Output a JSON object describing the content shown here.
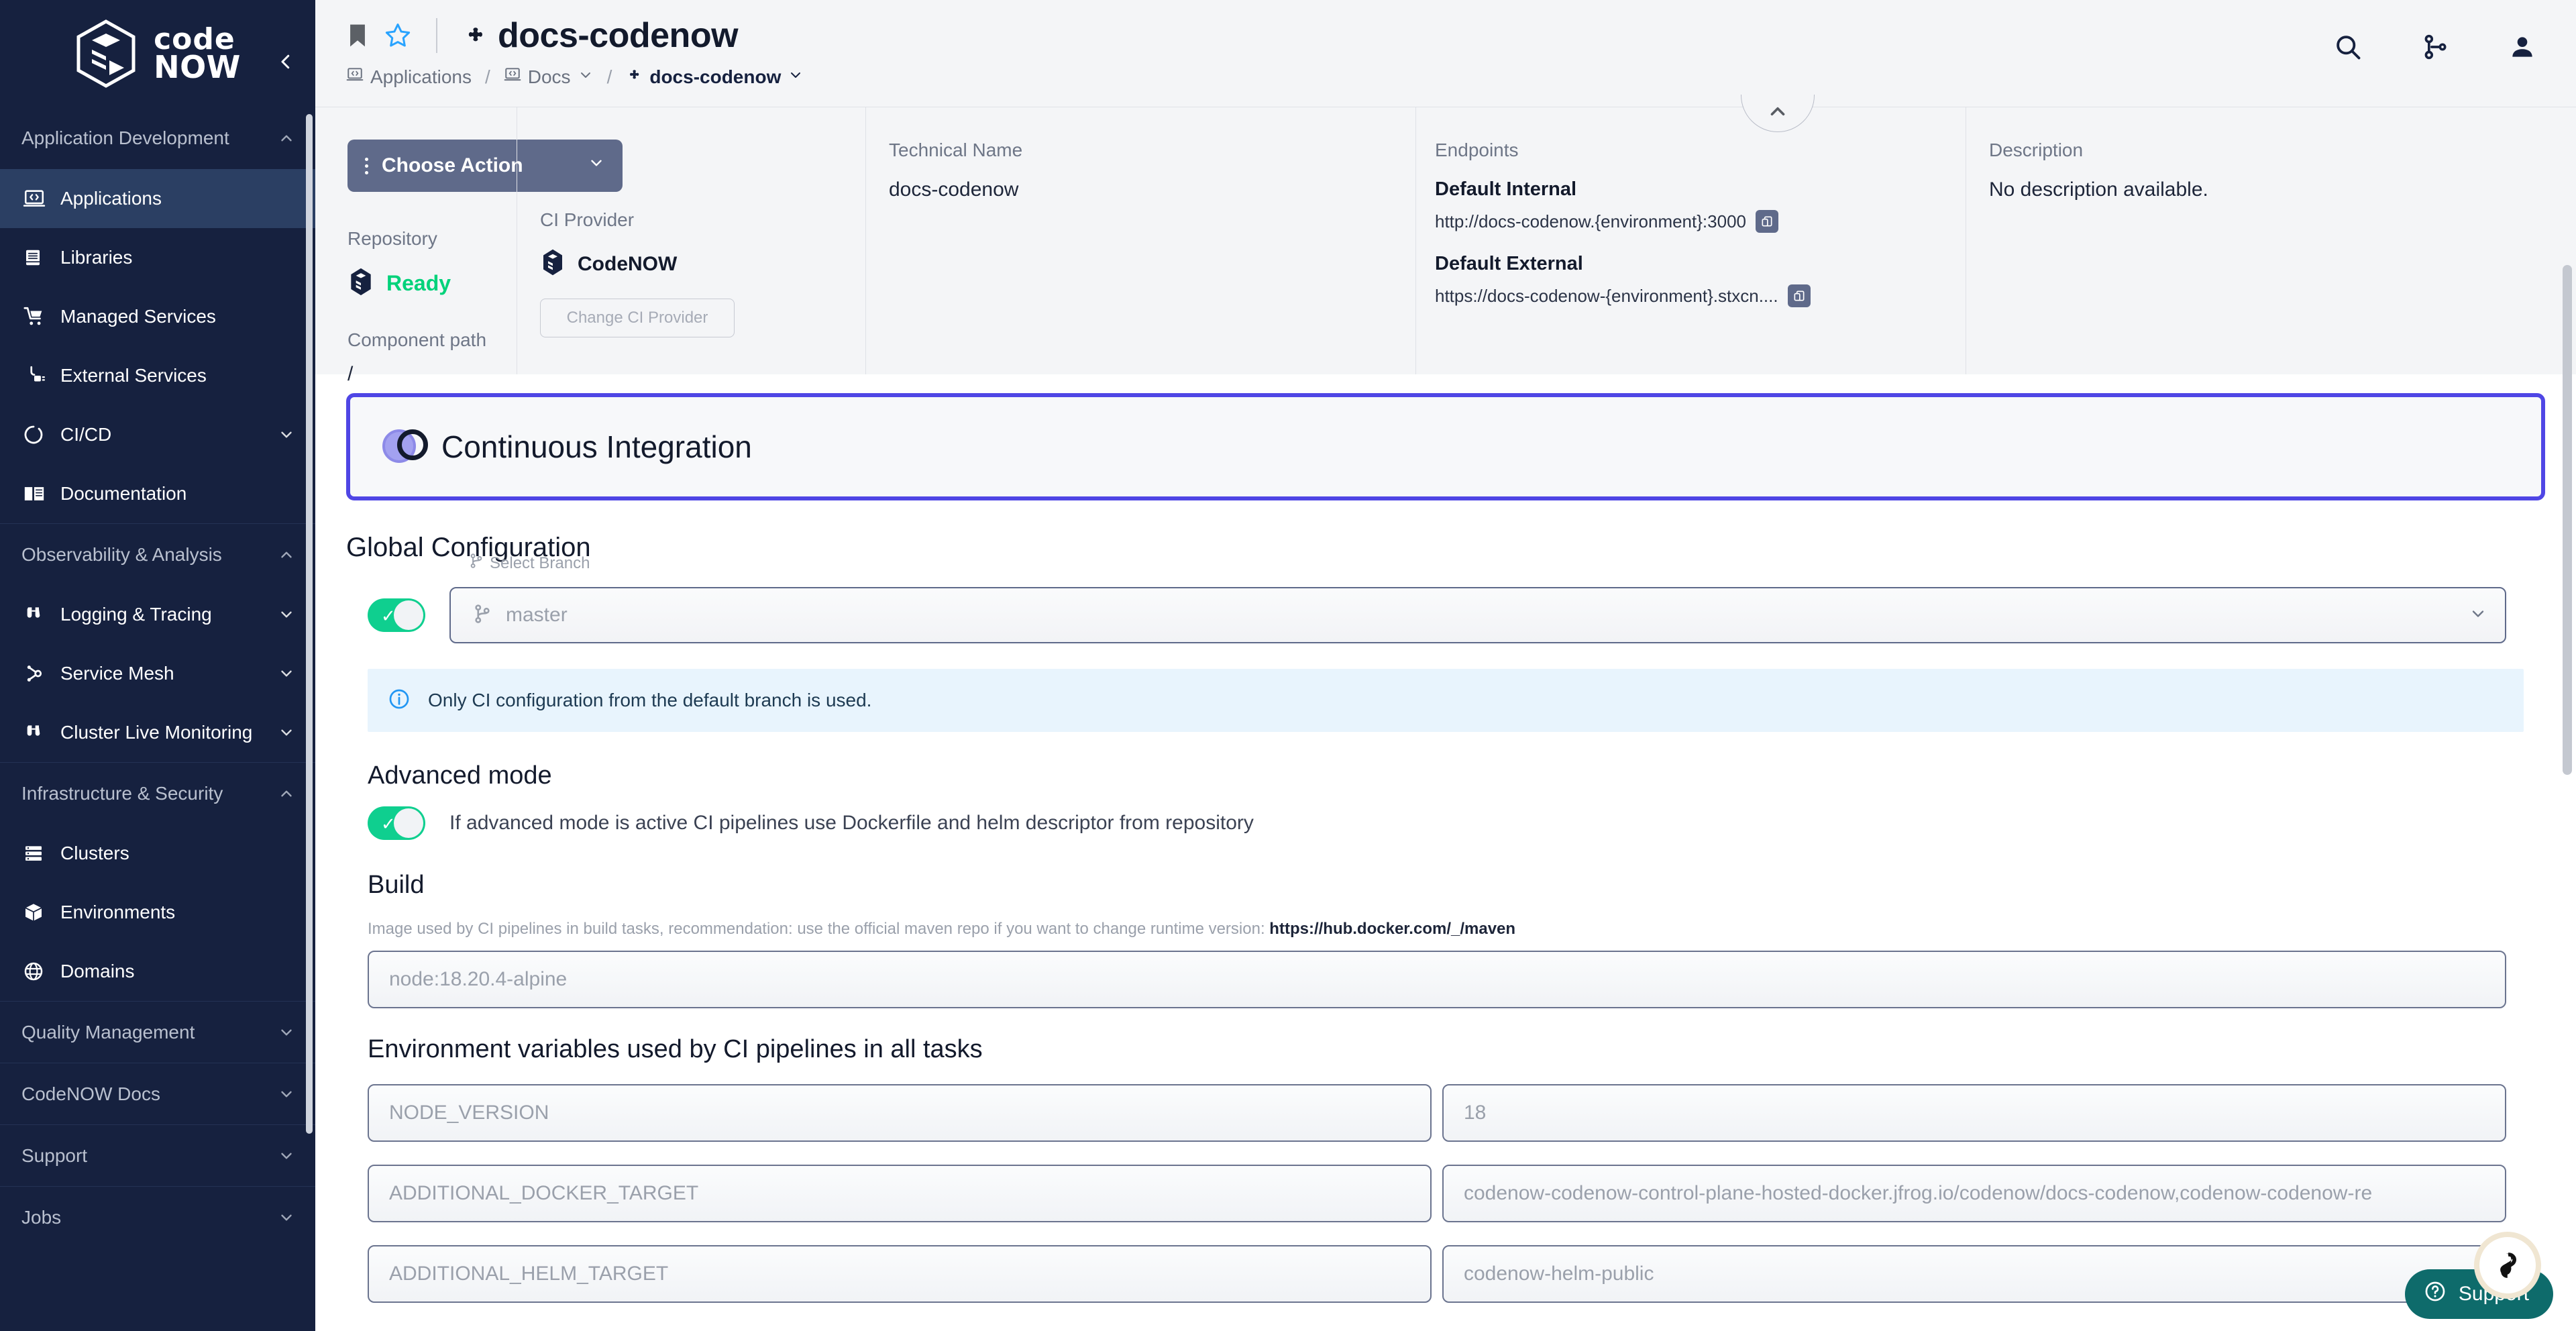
{
  "brand": {
    "logo_line1": "code",
    "logo_line2": "NOW"
  },
  "sidebar": {
    "groups": [
      {
        "label": "Application Development",
        "expanded": true,
        "items": [
          {
            "label": "Applications",
            "icon": "laptop-code-icon",
            "active": true
          },
          {
            "label": "Libraries",
            "icon": "book-icon",
            "active": false
          },
          {
            "label": "Managed Services",
            "icon": "cart-icon",
            "active": false
          },
          {
            "label": "External Services",
            "icon": "plug-icon",
            "active": false
          },
          {
            "label": "CI/CD",
            "icon": "cycle-icon",
            "active": false,
            "expandable": true
          },
          {
            "label": "Documentation",
            "icon": "open-book-icon",
            "active": false
          }
        ]
      },
      {
        "label": "Observability & Analysis",
        "expanded": true,
        "items": [
          {
            "label": "Logging & Tracing",
            "icon": "binoculars-icon",
            "active": false,
            "expandable": true
          },
          {
            "label": "Service Mesh",
            "icon": "mesh-icon",
            "active": false,
            "expandable": true
          },
          {
            "label": "Cluster Live Monitoring",
            "icon": "binoculars-icon",
            "active": false,
            "expandable": true
          }
        ]
      },
      {
        "label": "Infrastructure & Security",
        "expanded": true,
        "items": [
          {
            "label": "Clusters",
            "icon": "server-icon",
            "active": false
          },
          {
            "label": "Environments",
            "icon": "cube-icon",
            "active": false
          },
          {
            "label": "Domains",
            "icon": "globe-icon",
            "active": false
          }
        ]
      },
      {
        "label": "Quality Management",
        "expanded": false,
        "items": []
      },
      {
        "label": "CodeNOW Docs",
        "expanded": false,
        "items": []
      },
      {
        "label": "Support",
        "expanded": false,
        "items": []
      },
      {
        "label": "Jobs",
        "expanded": false,
        "items": []
      }
    ]
  },
  "topbar": {
    "title": "docs-codenow",
    "title_icon": "puzzle-piece-icon",
    "bookmark_icon": "bookmark-icon",
    "star_icon": "star-outline-icon",
    "breadcrumb": [
      {
        "label": "Applications",
        "icon": "laptop-code-icon",
        "dropdown": false
      },
      {
        "label": "Docs",
        "icon": "laptop-code-icon",
        "dropdown": true
      },
      {
        "label": "docs-codenow",
        "icon": "puzzle-piece-icon",
        "dropdown": true
      }
    ],
    "actions": [
      {
        "name": "search-icon"
      },
      {
        "name": "pipeline-icon"
      },
      {
        "name": "user-account-icon"
      }
    ],
    "collapse_icon": "chevron-up-icon"
  },
  "info": {
    "choose_action_label": "Choose Action",
    "repository": {
      "label": "Repository",
      "status": "Ready",
      "status_color": "#00d27a"
    },
    "component_path": {
      "label": "Component path",
      "value": "/"
    },
    "ci_provider": {
      "label": "CI Provider",
      "value": "CodeNOW",
      "change_button": "Change CI Provider"
    },
    "technical_name": {
      "label": "Technical Name",
      "value": "docs-codenow"
    },
    "endpoints": {
      "label": "Endpoints",
      "items": [
        {
          "name": "Default Internal",
          "url": "http://docs-codenow.{environment}:3000"
        },
        {
          "name": "Default External",
          "url": "https://docs-codenow-{environment}.stxcn...."
        }
      ]
    },
    "description": {
      "label": "Description",
      "value": "No description available."
    }
  },
  "ci": {
    "banner_title": "Continuous Integration",
    "banner_icon": "continuous-integration-icon",
    "banner_border_color": "#4f46e5",
    "global_configuration": {
      "heading": "Global Configuration",
      "toggle_on": true,
      "branch_label": "Select Branch",
      "branch_value": "master",
      "alert_text": "Only CI configuration from the default branch is used.",
      "alert_icon": "info-circle-icon"
    },
    "advanced_mode": {
      "heading": "Advanced mode",
      "toggle_on": true,
      "description": "If advanced mode is active CI pipelines use Dockerfile and helm descriptor from repository"
    },
    "build": {
      "heading": "Build",
      "image_hint_prefix": "Image used by CI pipelines in build tasks, recommendation: use the official maven repo if you want to change runtime version:",
      "image_hint_link": "https://hub.docker.com/_/maven",
      "image_value": "node:18.20.4-alpine",
      "env_heading": "Environment variables used by CI pipelines in all tasks",
      "env_vars": [
        {
          "key": "NODE_VERSION",
          "value": "18"
        },
        {
          "key": "ADDITIONAL_DOCKER_TARGET",
          "value": "codenow-codenow-control-plane-hosted-docker.jfrog.io/codenow/docs-codenow,codenow-codenow-re"
        },
        {
          "key": "ADDITIONAL_HELM_TARGET",
          "value": "codenow-helm-public"
        }
      ]
    }
  },
  "support_widget": {
    "label": "Support",
    "icon": "question-circle-icon",
    "badge_icon": "agent-avatar-icon"
  }
}
